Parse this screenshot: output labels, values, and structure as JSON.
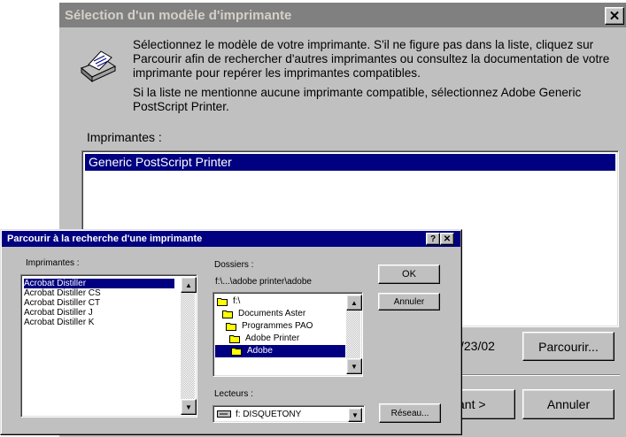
{
  "main_dialog": {
    "title": "Sélection d'un modèle d'imprimante",
    "close_glyph": "✕",
    "description_1": "Sélectionnez le modèle de votre imprimante. S'il ne figure pas dans la liste, cliquez sur Parcourir afin de rechercher d'autres imprimantes ou consultez la documentation de votre imprimante pour repérer les imprimantes compatibles.",
    "description_2": "Si la liste ne mentionne aucune imprimante compatible, sélectionnez Adobe Generic PostScript Printer.",
    "printers_label": "Imprimantes :",
    "printers": [
      "Generic PostScript Printer"
    ],
    "version_text": "/23/02",
    "browse_button": "Parcourir...",
    "next_button": "ant >",
    "cancel_button": "Annuler"
  },
  "browse_dialog": {
    "title": "Parcourir à la recherche d'une imprimante",
    "help_glyph": "?",
    "close_glyph": "✕",
    "printers_label": "Imprimantes :",
    "printers": [
      "Acrobat Distiller",
      "Acrobat Distiller CS",
      "Acrobat Distiller CT",
      "Acrobat Distiller J",
      "Acrobat Distiller K"
    ],
    "folders_label": "Dossiers :",
    "current_path": "f:\\...\\adobe printer\\adobe",
    "folders": [
      "f:\\",
      "Documents Aster",
      "Programmes PAO",
      "Adobe Printer",
      "Adobe"
    ],
    "ok_button": "OK",
    "cancel_button": "Annuler",
    "drives_label": "Lecteurs :",
    "drive_value": "f: DISQUETONY",
    "network_button": "Réseau..."
  },
  "colors": {
    "selection": "#000080",
    "face": "#c0c0c0",
    "inactive_title": "#808080",
    "folder": "#ffff00"
  }
}
